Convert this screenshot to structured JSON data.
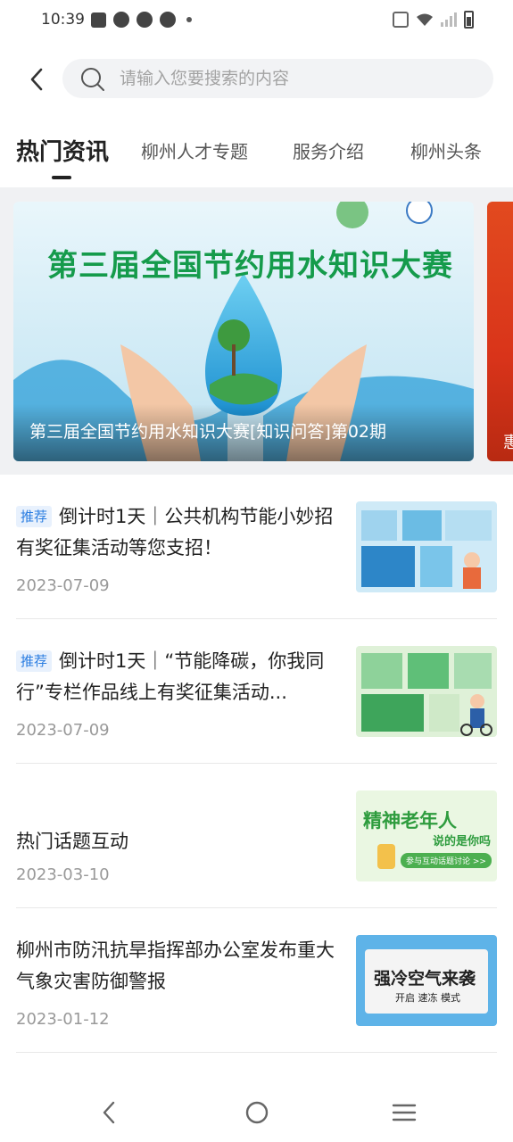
{
  "status_bar": {
    "time": "10:39"
  },
  "search": {
    "placeholder": "请输入您要搜索的内容",
    "value": ""
  },
  "tabs": [
    {
      "label": "热门资讯",
      "active": true
    },
    {
      "label": "柳州人才专题",
      "active": false
    },
    {
      "label": "服务介绍",
      "active": false
    },
    {
      "label": "柳州头条",
      "active": false
    }
  ],
  "banner": {
    "caption": "第三届全国节约用水知识大赛[知识问答]第02期",
    "image_headline": "第三届全国节约用水知识大赛",
    "next_caption_fragment": "惠"
  },
  "news": [
    {
      "tag": "推荐",
      "title": "倒计时1天｜公共机构节能小妙招有奖征集活动等您支招！",
      "date": "2023-07-09"
    },
    {
      "tag": "推荐",
      "title": "倒计时1天｜“节能降碳，你我同行”专栏作品线上有奖征集活动...",
      "date": "2023-07-09"
    },
    {
      "tag": "",
      "title": "热门话题互动",
      "date": "2023-03-10",
      "thumb_text": "精神老年人",
      "thumb_sub": "说的是你吗",
      "thumb_btn": "参与互动话题讨论 >>"
    },
    {
      "tag": "",
      "title": "柳州市防汛抗旱指挥部办公室发布重大气象灾害防御警报",
      "date": "2023-01-12",
      "thumb_text": "强冷空气来袭",
      "thumb_sub": "开启 速冻 模式"
    }
  ],
  "colors": {
    "accent": "#2a7de1",
    "tag_bg": "#e8f1fd",
    "date": "#999999"
  }
}
